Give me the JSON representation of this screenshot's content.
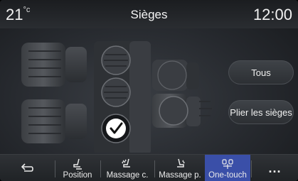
{
  "status": {
    "temperature": "21",
    "temperature_unit": "°c",
    "title": "Sièges",
    "clock": "12:00"
  },
  "buttons": {
    "all_label": "Tous",
    "fold_label": "Plier les sièges"
  },
  "navbar": {
    "back_icon": "back-arrow-icon",
    "items": [
      {
        "label": "Position",
        "icon": "seat-position-icon"
      },
      {
        "label": "Massage c.",
        "icon": "massage-driver-icon"
      },
      {
        "label": "Massage p.",
        "icon": "massage-passenger-icon"
      },
      {
        "label": "One-touch",
        "icon": "one-touch-icon",
        "active": true
      }
    ],
    "more_label": "..."
  },
  "colors": {
    "accent": "#3a4fa8",
    "background": "#26292e",
    "text": "#ffffff"
  }
}
